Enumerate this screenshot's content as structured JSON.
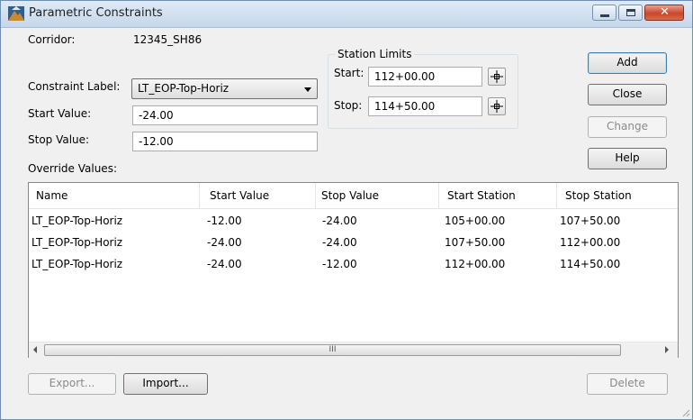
{
  "window": {
    "title": "Parametric Constraints",
    "close_glyph": "✕"
  },
  "form": {
    "corridor_label": "Corridor:",
    "corridor_value": "12345_SH86",
    "constraint_label_label": "Constraint Label:",
    "constraint_label_value": "LT_EOP-Top-Horiz",
    "start_value_label": "Start Value:",
    "start_value": "-24.00",
    "stop_value_label": "Stop Value:",
    "stop_value": "-12.00",
    "override_label": "Override Values:"
  },
  "station_limits": {
    "title": "Station Limits",
    "start_label": "Start:",
    "start_value": "112+00.00",
    "stop_label": "Stop:",
    "stop_value": "114+50.00"
  },
  "buttons": {
    "add": "Add",
    "close": "Close",
    "change": "Change",
    "help": "Help",
    "export": "Export...",
    "import": "Import...",
    "delete": "Delete"
  },
  "table": {
    "columns": [
      "Name",
      "Start Value",
      "Stop Value",
      "Start Station",
      "Stop Station"
    ],
    "rows": [
      [
        "LT_EOP-Top-Horiz",
        "-12.00",
        "-24.00",
        "105+00.00",
        "107+50.00"
      ],
      [
        "LT_EOP-Top-Horiz",
        "-24.00",
        "-24.00",
        "107+50.00",
        "112+00.00"
      ],
      [
        "LT_EOP-Top-Horiz",
        "-24.00",
        "-12.00",
        "112+00.00",
        "114+50.00"
      ]
    ],
    "scroll_thumb_grip": "III"
  },
  "colors": {
    "title_bar": "#c6d7eb",
    "close_button": "#c9462c",
    "default_button_border": "#3c7fb1"
  }
}
